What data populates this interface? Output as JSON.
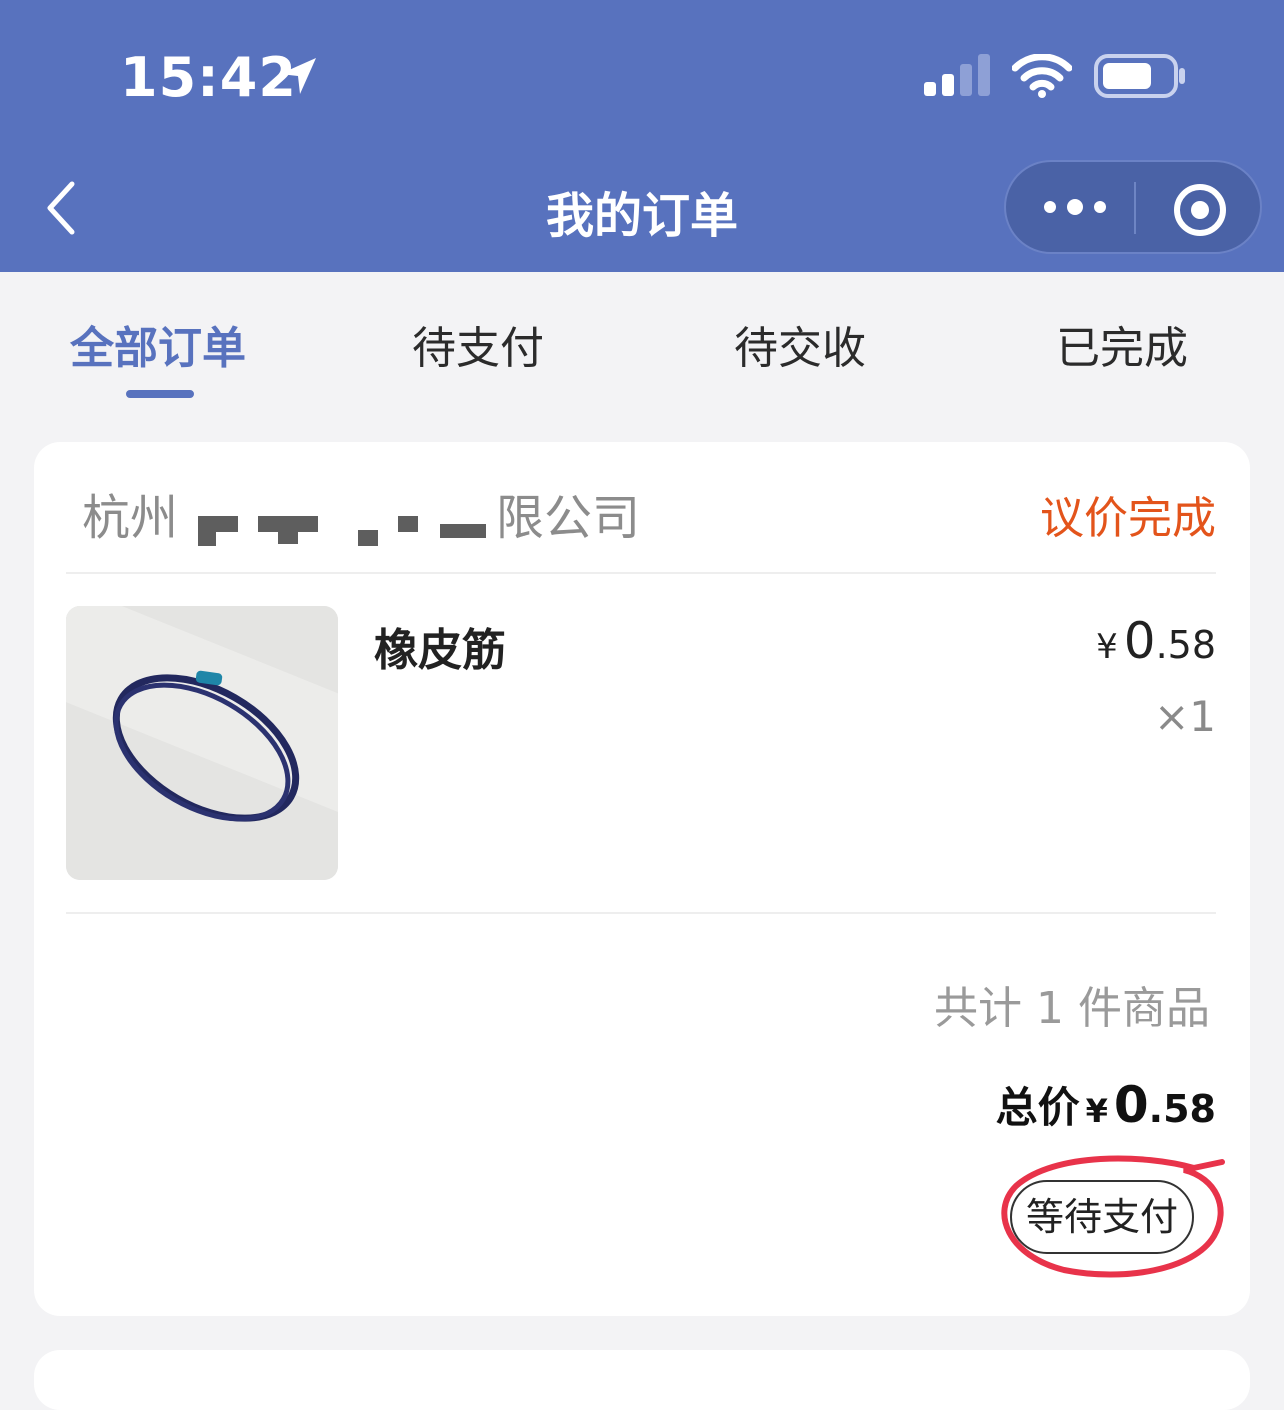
{
  "status_bar": {
    "time": "15:42"
  },
  "nav": {
    "title": "我的订单"
  },
  "tabs": [
    {
      "label": "全部订单",
      "active": true
    },
    {
      "label": "待支付",
      "active": false
    },
    {
      "label": "待交收",
      "active": false
    },
    {
      "label": "已完成",
      "active": false
    }
  ],
  "order": {
    "company_prefix": "杭州",
    "company_suffix": "限公司",
    "status": "议价完成",
    "product": {
      "name": "橡皮筋",
      "currency": "¥",
      "price_int": "0",
      "price_dec": ".58",
      "quantity": "×1"
    },
    "summary": "共计 1 件商品",
    "total_label": "总价",
    "total_currency": "¥",
    "total_int": "0",
    "total_dec": ".58",
    "action_label": "等待支付"
  },
  "colors": {
    "header": "#5872be",
    "accent": "#5872be",
    "status_orange": "#e3541b",
    "annotation_red": "#e8334a"
  }
}
